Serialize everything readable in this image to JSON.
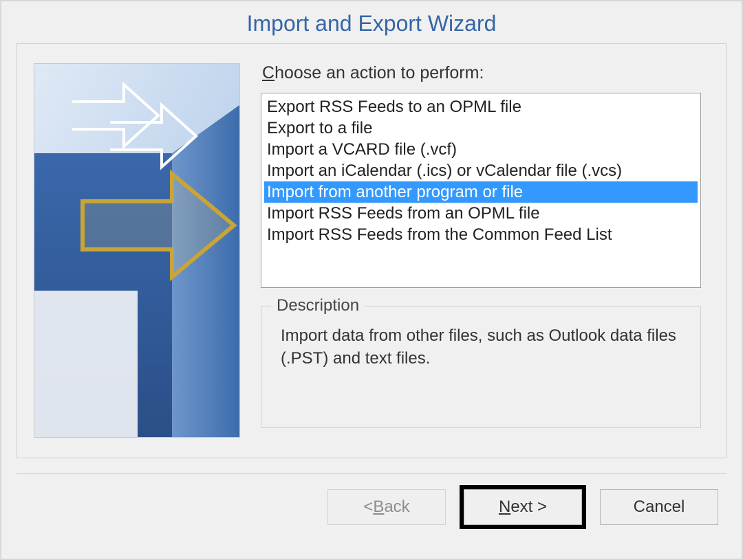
{
  "title": "Import and Export Wizard",
  "prompt_prefix": "C",
  "prompt_rest": "hoose an action to perform:",
  "options": [
    "Export RSS Feeds to an OPML file",
    "Export to a file",
    "Import a VCARD file (.vcf)",
    "Import an iCalendar (.ics) or vCalendar file (.vcs)",
    "Import from another program or file",
    "Import RSS Feeds from an OPML file",
    "Import RSS Feeds from the Common Feed List"
  ],
  "selected_index": 4,
  "description_label": "Description",
  "description_text": "Import data from other files, such as Outlook data files (.PST) and text files.",
  "buttons": {
    "back_sym": "< ",
    "back_u": "B",
    "back_rest": "ack",
    "next_u": "N",
    "next_rest": "ext >",
    "cancel": "Cancel"
  }
}
